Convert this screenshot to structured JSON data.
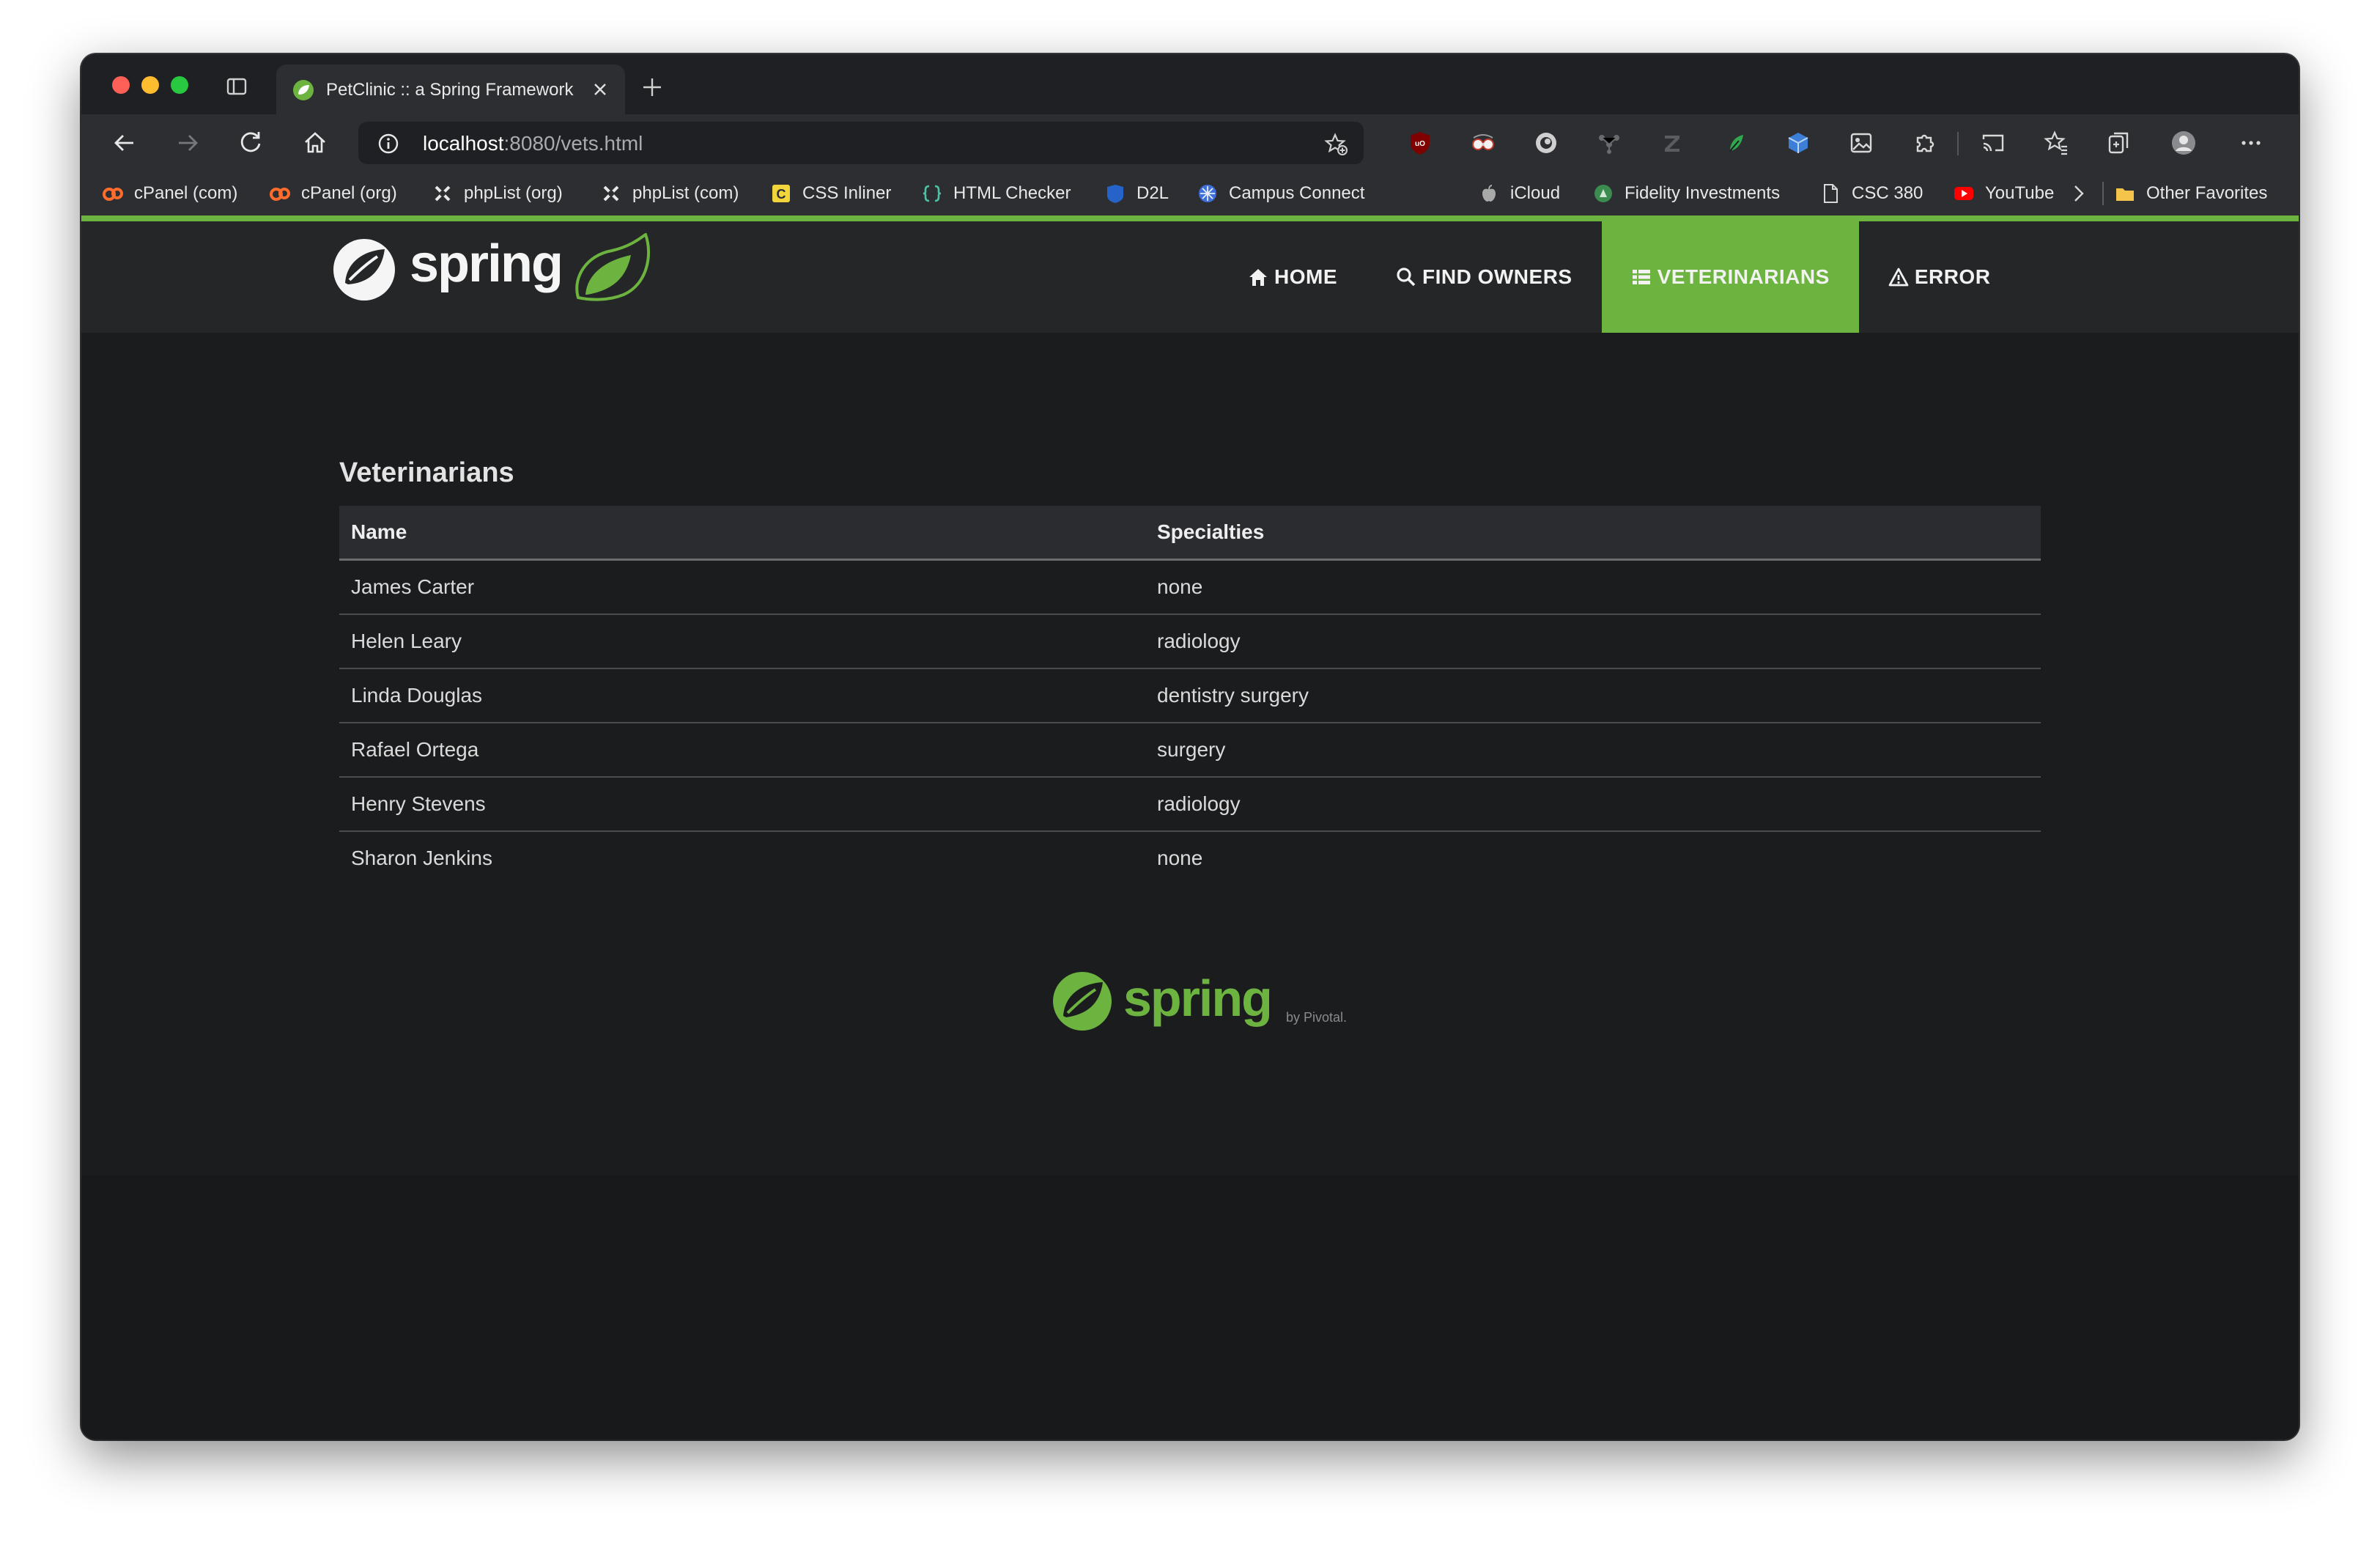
{
  "browser": {
    "tab": {
      "title": "PetClinic :: a Spring Framework demonstration"
    },
    "url": {
      "host": "localhost",
      "path": ":8080/vets.html"
    },
    "bookmarks": [
      {
        "label": "cPanel (com)",
        "icon": "cpanel-icon"
      },
      {
        "label": "cPanel (org)",
        "icon": "cpanel-icon"
      },
      {
        "label": "phpList (org)",
        "icon": "phplist-icon"
      },
      {
        "label": "phpList (com)",
        "icon": "phplist-icon"
      },
      {
        "label": "CSS Inliner",
        "icon": "css-inliner-icon"
      },
      {
        "label": "HTML Checker",
        "icon": "html-checker-icon"
      },
      {
        "label": "D2L",
        "icon": "d2l-icon"
      },
      {
        "label": "Campus Connect",
        "icon": "campus-connect-icon"
      },
      {
        "label": "iCloud",
        "icon": "apple-icon"
      },
      {
        "label": "Fidelity Investments",
        "icon": "fidelity-icon"
      },
      {
        "label": "CSC 380",
        "icon": "page-icon"
      },
      {
        "label": "YouTube",
        "icon": "youtube-icon"
      },
      {
        "label": "Other Favorites",
        "icon": "folder-icon"
      }
    ]
  },
  "app": {
    "brand": "spring",
    "footer_brand": "spring",
    "footer_byline": "by Pivotal.",
    "nav": [
      {
        "label": "HOME",
        "icon": "home-icon"
      },
      {
        "label": "FIND OWNERS",
        "icon": "search-icon"
      },
      {
        "label": "VETERINARIANS",
        "icon": "list-icon",
        "active": true
      },
      {
        "label": "ERROR",
        "icon": "warning-icon"
      }
    ],
    "heading": "Veterinarians",
    "table": {
      "columns": [
        "Name",
        "Specialties"
      ],
      "rows": [
        [
          "James Carter",
          "none"
        ],
        [
          "Helen Leary",
          "radiology"
        ],
        [
          "Linda Douglas",
          "dentistry surgery"
        ],
        [
          "Rafael Ortega",
          "surgery"
        ],
        [
          "Henry Stevens",
          "radiology"
        ],
        [
          "Sharon Jenkins",
          "none"
        ]
      ]
    }
  },
  "colors": {
    "accent": "#6db33f",
    "page_bg": "#1b1c1e",
    "navbar_bg": "#242628"
  }
}
